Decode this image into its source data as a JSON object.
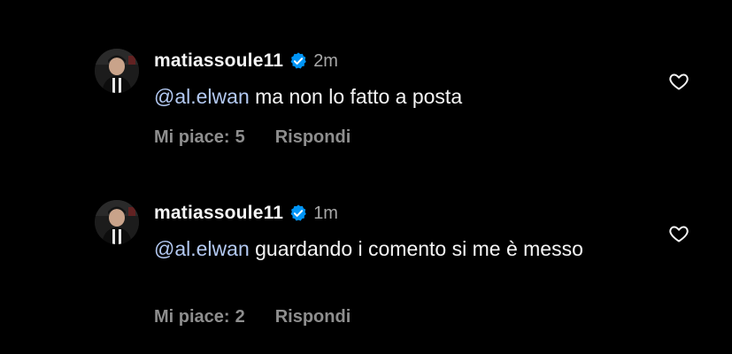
{
  "comments": [
    {
      "username": "matiassoule11",
      "verified": true,
      "time": "2m",
      "mention": "@al.elwan",
      "text": "ma non lo fatto a posta",
      "likes_label": "Mi piace:",
      "likes_count": "5",
      "reply_label": "Rispondi",
      "icon": "heart-outline-icon"
    },
    {
      "username": "matiassoule11",
      "verified": true,
      "time": "1m",
      "mention": "@al.elwan",
      "text": "guardando i comento si me è messo",
      "likes_label": "Mi piace:",
      "likes_count": "2",
      "reply_label": "Rispondi",
      "icon": "heart-outline-icon"
    }
  ],
  "colors": {
    "background": "#000000",
    "text": "#f5f5f5",
    "mention": "#b3c9f2",
    "muted": "#8e8e8e",
    "verified_badge": "#0095f6"
  }
}
